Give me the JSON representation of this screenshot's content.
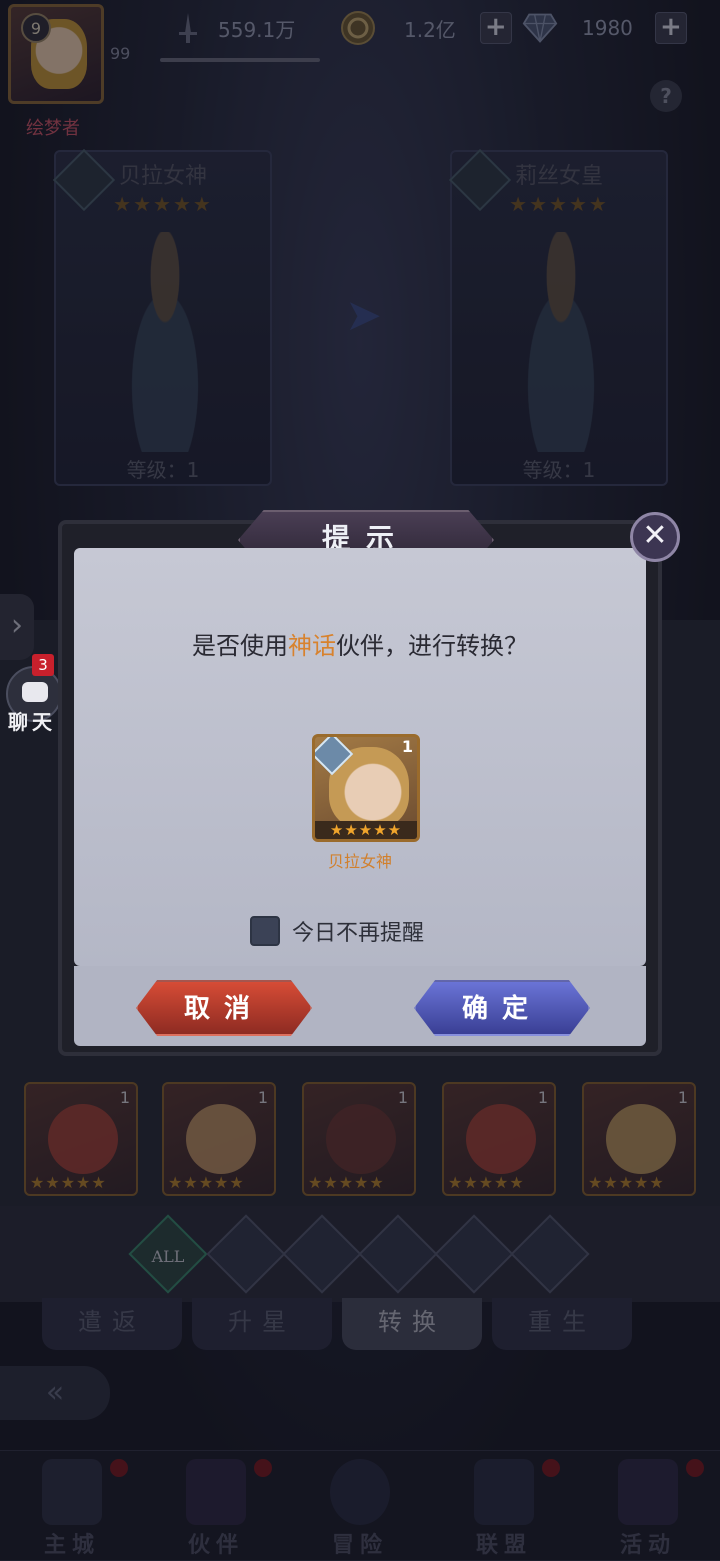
{
  "player": {
    "level": "9",
    "vip": "99",
    "name": "绘梦者"
  },
  "resources": {
    "power": "559.1万",
    "gold": "1.2亿",
    "gems": "1980"
  },
  "heroes": {
    "left": {
      "name": "贝拉女神",
      "stars": "★★★★★",
      "level": "等级：1"
    },
    "right": {
      "name": "莉丝女皇",
      "stars": "★★★★★",
      "level": "等级：1"
    }
  },
  "chat": {
    "badge": "3",
    "label": "聊天"
  },
  "grid_icons": [
    {
      "num": "1",
      "stars": "★★★★★"
    },
    {
      "num": "1",
      "stars": "★★★★★"
    },
    {
      "num": "1",
      "stars": "★★★★★"
    },
    {
      "num": "1",
      "stars": "★★★★★"
    },
    {
      "num": "1",
      "stars": "★★★★★"
    }
  ],
  "filters": {
    "all": "ALL"
  },
  "subtabs": [
    "遣返",
    "升星",
    "转换",
    "重生"
  ],
  "active_subtab": "转换",
  "nav": [
    "主城",
    "伙伴",
    "冒险",
    "联盟",
    "活动"
  ],
  "dialog": {
    "title": "提示",
    "question_pre": "是否使用",
    "question_highlight": "神话",
    "question_post": "伙伴，进行转换？",
    "card": {
      "num": "1",
      "stars": "★★★★★",
      "name": "贝拉女神"
    },
    "checkbox_label": "今日不再提醒",
    "cancel": "取消",
    "confirm": "确定",
    "close_icon": "✕"
  },
  "colors": {
    "highlight": "#d8822d",
    "cancel": "#c2432f",
    "confirm": "#5560c4"
  }
}
